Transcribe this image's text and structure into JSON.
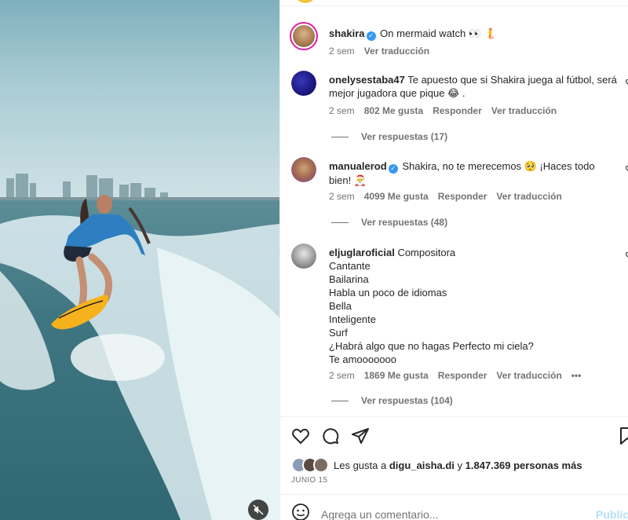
{
  "post": {
    "author": "shakira",
    "caption": "On mermaid watch 👀 🧜",
    "time": "2 sem",
    "translate": "Ver traducción"
  },
  "comments": [
    {
      "username": "onelysestaba47",
      "text": "Te apuesto que si Shakira juega al fútbol, será mejor jugadora que pique 😂 .",
      "time": "2 sem",
      "likes": "802 Me gusta",
      "reply": "Responder",
      "translate": "Ver traducción",
      "view_replies": "Ver respuestas (17)"
    },
    {
      "username": "manualerod",
      "text": "Shakira, no te merecemos 🥺 ¡Haces todo bien! 🎅",
      "time": "2 sem",
      "likes": "4099 Me gusta",
      "reply": "Responder",
      "translate": "Ver traducción",
      "view_replies": "Ver respuestas (48)"
    },
    {
      "username": "eljuglaroficial",
      "lines": [
        "Compositora",
        "Cantante",
        "Bailarina",
        "Habla un poco de idiomas",
        "Bella",
        "Inteligente",
        "Surf",
        "¿Habrá algo que no hagas Perfecto mi ciela?",
        "Te amooooooo"
      ],
      "time": "2 sem",
      "likes": "1869 Me gusta",
      "reply": "Responder",
      "translate": "Ver traducción",
      "more": "•••",
      "view_replies": "Ver respuestas (104)"
    }
  ],
  "likes_bar": {
    "prefix": "Les gusta a",
    "user": "digu_aisha.di",
    "joiner": "y",
    "count": "1.847.369 personas más"
  },
  "date": "JUNIO 15",
  "add_comment": {
    "placeholder": "Agrega un comentario...",
    "post_label": "Publica"
  },
  "icons": {
    "like": "heart-icon",
    "comment": "comment-icon",
    "share": "share-icon",
    "save": "bookmark-icon",
    "emoji": "emoji-icon",
    "mute": "muted-speaker-icon"
  },
  "colors": {
    "verified": "#3897f0",
    "post_button": "#b2dffc",
    "secondary_text": "#737373"
  }
}
